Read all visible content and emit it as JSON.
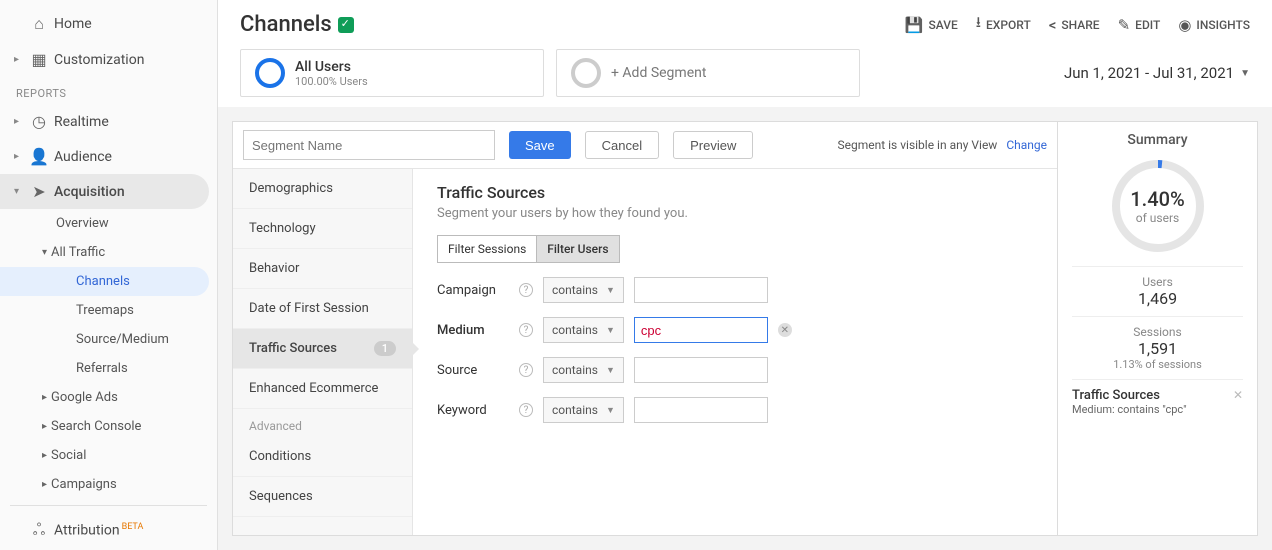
{
  "sidebar": {
    "home": "Home",
    "customization": "Customization",
    "reports_header": "REPORTS",
    "realtime": "Realtime",
    "audience": "Audience",
    "acquisition": "Acquisition",
    "overview": "Overview",
    "all_traffic": "All Traffic",
    "channels": "Channels",
    "treemaps": "Treemaps",
    "source_medium": "Source/Medium",
    "referrals": "Referrals",
    "google_ads": "Google Ads",
    "search_console": "Search Console",
    "social": "Social",
    "campaigns": "Campaigns",
    "attribution": "Attribution",
    "beta": "BETA"
  },
  "header": {
    "title": "Channels",
    "actions": {
      "save": "SAVE",
      "export": "EXPORT",
      "share": "SHARE",
      "edit": "EDIT",
      "insights": "INSIGHTS"
    }
  },
  "segments": {
    "all_users": "All Users",
    "all_users_pct": "100.00% Users",
    "add_segment": "+ Add Segment",
    "date_range": "Jun 1, 2021 - Jul 31, 2021"
  },
  "editor": {
    "name_placeholder": "Segment Name",
    "save": "Save",
    "cancel": "Cancel",
    "preview": "Preview",
    "visibility": "Segment is visible in any View",
    "change": "Change"
  },
  "categories": {
    "demographics": "Demographics",
    "technology": "Technology",
    "behavior": "Behavior",
    "first_session": "Date of First Session",
    "traffic_sources": "Traffic Sources",
    "traffic_badge": "1",
    "ecommerce": "Enhanced Ecommerce",
    "advanced": "Advanced",
    "conditions": "Conditions",
    "sequences": "Sequences"
  },
  "form": {
    "title": "Traffic Sources",
    "subtitle": "Segment your users by how they found you.",
    "tab_sessions": "Filter Sessions",
    "tab_users": "Filter Users",
    "campaign": "Campaign",
    "medium": "Medium",
    "source": "Source",
    "keyword": "Keyword",
    "contains": "contains",
    "medium_value": "cpc"
  },
  "summary": {
    "title": "Summary",
    "pct": "1.40%",
    "of_users": "of users",
    "users_label": "Users",
    "users_val": "1,469",
    "sessions_label": "Sessions",
    "sessions_val": "1,591",
    "sessions_note": "1.13% of sessions",
    "filter_label": "Traffic Sources",
    "filter_detail": "Medium: contains \"cpc\""
  }
}
